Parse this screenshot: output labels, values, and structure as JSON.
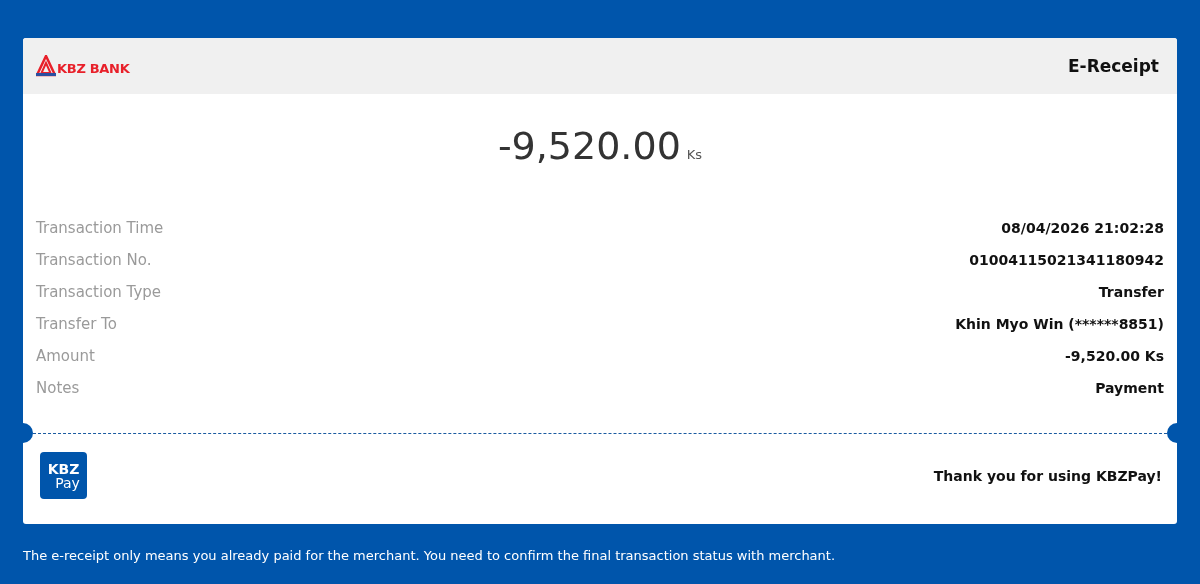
{
  "header": {
    "logo_text": "KBZ BANK",
    "title": "E-Receipt"
  },
  "amount": {
    "value": "-9,520.00",
    "currency": "Ks"
  },
  "details": [
    {
      "label": "Transaction Time",
      "value": "08/04/2026 21:02:28"
    },
    {
      "label": "Transaction No.",
      "value": "01004115021341180942"
    },
    {
      "label": "Transaction Type",
      "value": "Transfer"
    },
    {
      "label": "Transfer To",
      "value": "Khin Myo Win (******8851)"
    },
    {
      "label": "Amount",
      "value": "-9,520.00 Ks"
    },
    {
      "label": "Notes",
      "value": "Payment"
    }
  ],
  "footer": {
    "app_logo_top": "KBZ",
    "app_logo_bottom": "Pay",
    "thanks": "Thank you for using KBZPay!"
  },
  "disclaimer": "The e-receipt only means you already paid for the merchant. You need to confirm the final transaction status with merchant."
}
